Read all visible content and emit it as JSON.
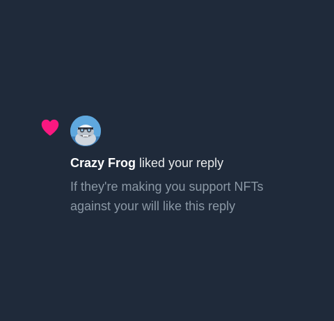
{
  "notification": {
    "type_icon": "heart-icon",
    "heart_color": "#f91880",
    "avatar_icon": "crazy-frog-avatar",
    "user_name": "Crazy Frog",
    "action_text": "liked your reply",
    "reply_text": "If they're making you support NFTs against your will like this reply"
  },
  "colors": {
    "background": "#1f2a3a",
    "primary_text": "#e7e9ea",
    "secondary_text": "#8b98a5"
  }
}
